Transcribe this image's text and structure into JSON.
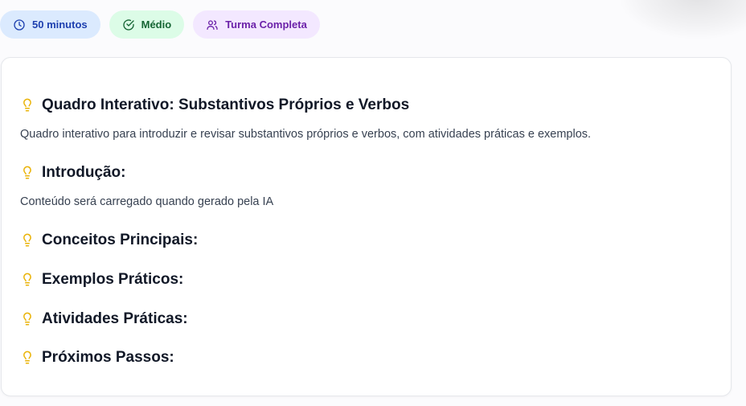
{
  "badges": {
    "duration": {
      "label": "50 minutos",
      "icon": "clock-icon"
    },
    "difficulty": {
      "label": "Médio",
      "icon": "check-circle-icon"
    },
    "audience": {
      "label": "Turma Completa",
      "icon": "users-icon"
    }
  },
  "card": {
    "title": "Quadro Interativo: Substantivos Próprios e Verbos",
    "description": "Quadro interativo para introduzir e revisar substantivos próprios e verbos, com atividades práticas e exemplos.",
    "sections": [
      {
        "heading": "Introdução:",
        "body": "Conteúdo será carregado quando gerado pela IA"
      },
      {
        "heading": "Conceitos Principais:"
      },
      {
        "heading": "Exemplos Práticos:"
      },
      {
        "heading": "Atividades Práticas:"
      },
      {
        "heading": "Próximos Passos:"
      }
    ]
  },
  "colors": {
    "accent_bulb": "#eab308",
    "time_badge_bg": "#dbeafe",
    "level_badge_bg": "#dcfce7",
    "class_badge_bg": "#f3e8ff"
  }
}
